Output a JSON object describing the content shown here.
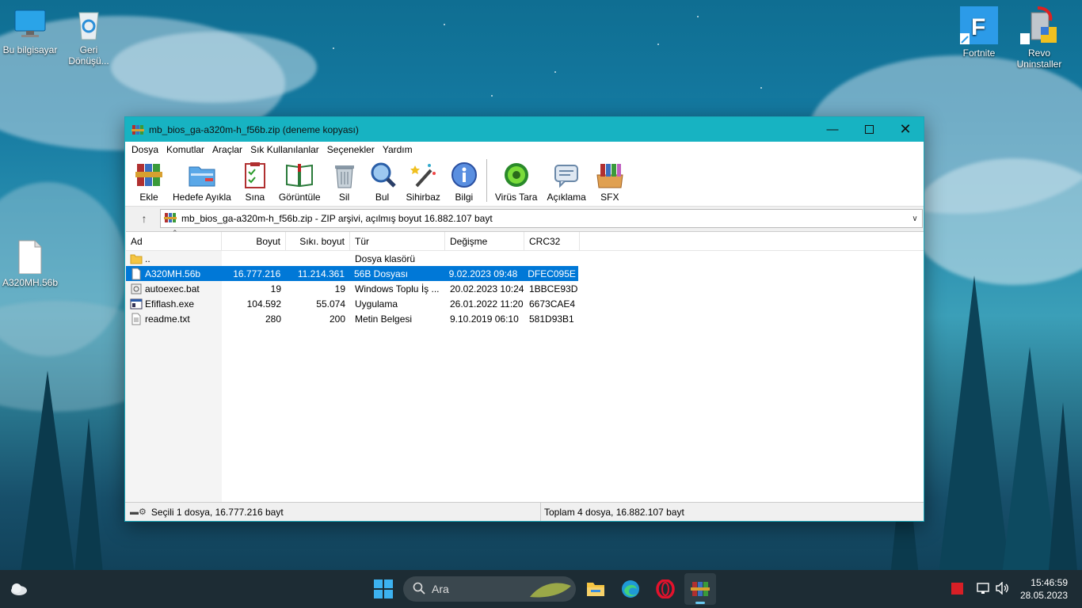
{
  "desktop": {
    "icons_left": [
      {
        "label": "Bu bilgisayar",
        "icon": "computer-icon"
      },
      {
        "label": "Geri Dönüşü...",
        "icon": "recycle-bin-icon"
      },
      {
        "label": "A320MH.56b",
        "icon": "file-icon"
      }
    ],
    "icons_right": [
      {
        "label": "Fortnite",
        "icon": "fortnite-icon"
      },
      {
        "label": "Revo Uninstaller",
        "icon": "revo-uninstaller-icon"
      }
    ]
  },
  "window": {
    "title": "mb_bios_ga-a320m-h_f56b.zip (deneme kopyası)",
    "menu": [
      "Dosya",
      "Komutlar",
      "Araçlar",
      "Sık Kullanılanlar",
      "Seçenekler",
      "Yardım"
    ],
    "toolbar": [
      {
        "label": "Ekle",
        "icon": "archive-add-icon"
      },
      {
        "label": "Hedefe Ayıkla",
        "icon": "extract-folder-icon"
      },
      {
        "label": "Sına",
        "icon": "test-clipboard-icon"
      },
      {
        "label": "Görüntüle",
        "icon": "view-book-icon"
      },
      {
        "label": "Sil",
        "icon": "trash-icon"
      },
      {
        "label": "Bul",
        "icon": "find-magnifier-icon"
      },
      {
        "label": "Sihirbaz",
        "icon": "wizard-wand-icon"
      },
      {
        "label": "Bilgi",
        "icon": "info-icon"
      },
      {
        "label": "Virüs Tara",
        "icon": "virus-scan-icon"
      },
      {
        "label": "Açıklama",
        "icon": "comment-icon"
      },
      {
        "label": "SFX",
        "icon": "sfx-box-icon"
      }
    ],
    "address": "mb_bios_ga-a320m-h_f56b.zip - ZIP arşivi, açılmış boyut 16.882.107 bayt",
    "columns": [
      "Ad",
      "Boyut",
      "Sıkı. boyut",
      "Tür",
      "Değişme",
      "CRC32"
    ],
    "rows": [
      {
        "name": "..",
        "size": "",
        "packed": "",
        "type": "Dosya klasörü",
        "modified": "",
        "crc": "",
        "icon": "folder-icon",
        "selected": false
      },
      {
        "name": "A320MH.56b",
        "size": "16.777.216",
        "packed": "11.214.361",
        "type": "56B Dosyası",
        "modified": "9.02.2023 09:48",
        "crc": "DFEC095E",
        "icon": "file-icon",
        "selected": true
      },
      {
        "name": "autoexec.bat",
        "size": "19",
        "packed": "19",
        "type": "Windows Toplu İş ...",
        "modified": "20.02.2023 10:24",
        "crc": "1BBCE93D",
        "icon": "batch-file-icon",
        "selected": false
      },
      {
        "name": "Efiflash.exe",
        "size": "104.592",
        "packed": "55.074",
        "type": "Uygulama",
        "modified": "26.01.2022 11:20",
        "crc": "6673CAE4",
        "icon": "exe-file-icon",
        "selected": false
      },
      {
        "name": "readme.txt",
        "size": "280",
        "packed": "200",
        "type": "Metin Belgesi",
        "modified": "9.10.2019 06:10",
        "crc": "581D93B1",
        "icon": "text-file-icon",
        "selected": false
      }
    ],
    "status_left": "Seçili 1 dosya, 16.777.216 bayt",
    "status_right": "Toplam 4 dosya, 16.882.107 bayt"
  },
  "taskbar": {
    "search_placeholder": "Ara",
    "time": "15:46:59",
    "date": "28.05.2023"
  },
  "colors": {
    "titlebar": "#17b3c2",
    "selection": "#0078d7",
    "taskbar": "#1d2c34"
  }
}
